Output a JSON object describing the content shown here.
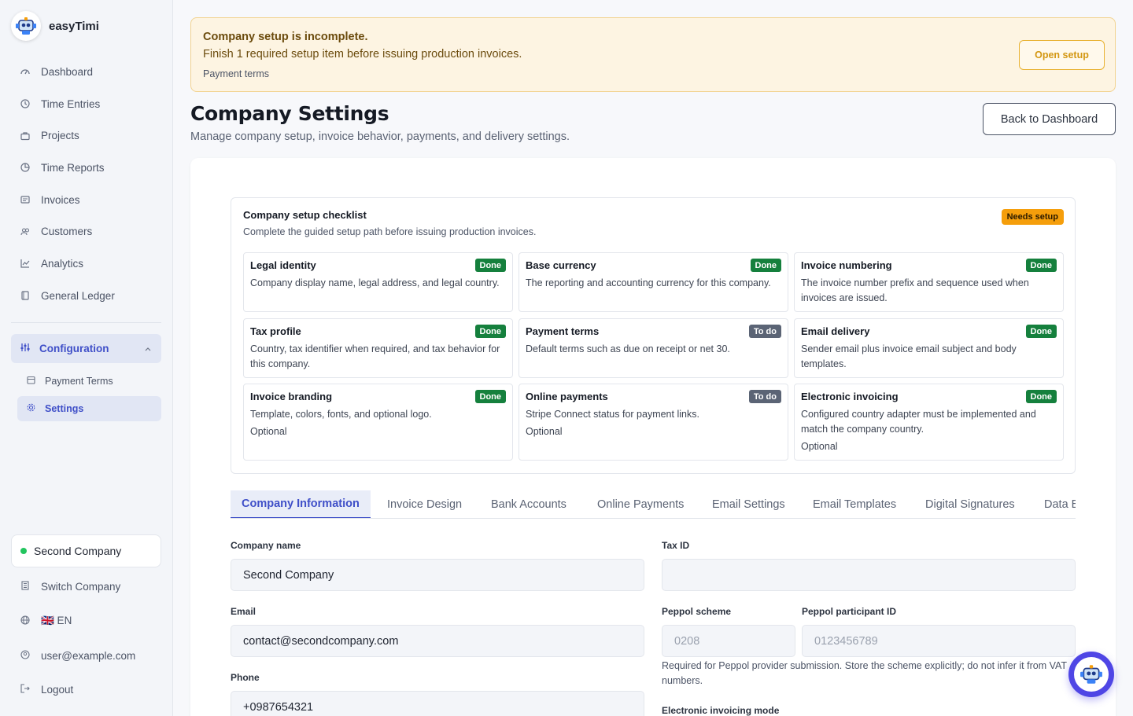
{
  "app": {
    "name": "easyTimi"
  },
  "sidebar": {
    "items": [
      {
        "label": "Dashboard",
        "icon": "dashboard-icon"
      },
      {
        "label": "Time Entries",
        "icon": "clock-icon"
      },
      {
        "label": "Projects",
        "icon": "briefcase-icon"
      },
      {
        "label": "Time Reports",
        "icon": "pie-chart-icon"
      },
      {
        "label": "Invoices",
        "icon": "invoice-icon"
      },
      {
        "label": "Customers",
        "icon": "users-icon"
      },
      {
        "label": "Analytics",
        "icon": "chart-line-icon"
      },
      {
        "label": "General Ledger",
        "icon": "book-icon"
      }
    ],
    "configuration": {
      "label": "Configuration",
      "expanded": true
    },
    "config_items": [
      {
        "label": "Payment Terms",
        "icon": "calendar-icon"
      },
      {
        "label": "Settings",
        "icon": "gear-icon",
        "active": true
      }
    ],
    "company": "Second Company",
    "switch_company": "Switch Company",
    "language": "🇬🇧 EN",
    "user": "user@example.com",
    "logout": "Logout"
  },
  "banner": {
    "title": "Company setup is incomplete.",
    "text": "Finish 1 required setup item before issuing production invoices.",
    "item": "Payment terms",
    "button": "Open setup"
  },
  "page": {
    "title": "Company Settings",
    "subtitle": "Manage company setup, invoice behavior, payments, and delivery settings.",
    "back_button": "Back to Dashboard"
  },
  "checklist": {
    "title": "Company setup checklist",
    "subtitle": "Complete the guided setup path before issuing production invoices.",
    "status": "Needs setup",
    "items": [
      {
        "title": "Legal identity",
        "desc": "Company display name, legal address, and legal country.",
        "status": "Done",
        "optional": ""
      },
      {
        "title": "Base currency",
        "desc": "The reporting and accounting currency for this company.",
        "status": "Done",
        "optional": ""
      },
      {
        "title": "Invoice numbering",
        "desc": "The invoice number prefix and sequence used when invoices are issued.",
        "status": "Done",
        "optional": ""
      },
      {
        "title": "Tax profile",
        "desc": "Country, tax identifier when required, and tax behavior for this company.",
        "status": "Done",
        "optional": ""
      },
      {
        "title": "Payment terms",
        "desc": "Default terms such as due on receipt or net 30.",
        "status": "To do",
        "optional": ""
      },
      {
        "title": "Email delivery",
        "desc": "Sender email plus invoice email subject and body templates.",
        "status": "Done",
        "optional": ""
      },
      {
        "title": "Invoice branding",
        "desc": "Template, colors, fonts, and optional logo.",
        "status": "Done",
        "optional": "Optional"
      },
      {
        "title": "Online payments",
        "desc": "Stripe Connect status for payment links.",
        "status": "To do",
        "optional": "Optional"
      },
      {
        "title": "Electronic invoicing",
        "desc": "Configured country adapter must be implemented and match the company country.",
        "status": "Done",
        "optional": "Optional"
      }
    ]
  },
  "tabs": [
    {
      "label": "Company Information",
      "active": true
    },
    {
      "label": "Invoice Design"
    },
    {
      "label": "Bank Accounts"
    },
    {
      "label": "Online Payments"
    },
    {
      "label": "Email Settings"
    },
    {
      "label": "Email Templates"
    },
    {
      "label": "Digital Signatures"
    },
    {
      "label": "Data Export"
    }
  ],
  "form": {
    "company_name": {
      "label": "Company name",
      "value": "Second Company"
    },
    "tax_id": {
      "label": "Tax ID",
      "value": ""
    },
    "email": {
      "label": "Email",
      "value": "contact@secondcompany.com"
    },
    "peppol_scheme": {
      "label": "Peppol scheme",
      "placeholder": "0208"
    },
    "peppol_id": {
      "label": "Peppol participant ID",
      "placeholder": "0123456789"
    },
    "peppol_help": "Required for Peppol provider submission. Store the scheme explicitly; do not infer it from VAT numbers.",
    "phone": {
      "label": "Phone",
      "value": "+0987654321"
    },
    "einvoicing_mode": {
      "label": "Electronic invoicing mode"
    }
  },
  "colors": {
    "accent": "#3f4fc8",
    "warning_bg": "#fdf4e2",
    "warning_border": "#f2d391",
    "done": "#15803d",
    "todo": "#5b6475",
    "needs_setup": "#f59e0b",
    "fab": "#4f46e5"
  }
}
